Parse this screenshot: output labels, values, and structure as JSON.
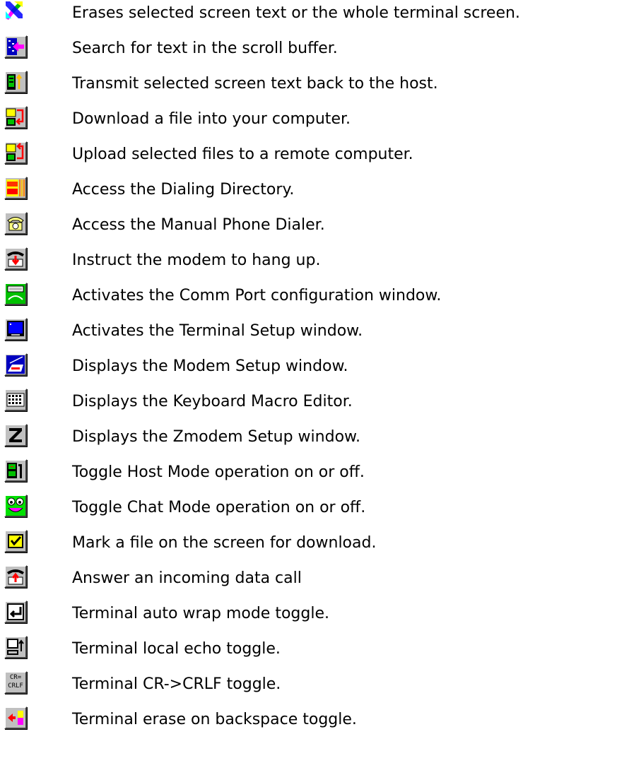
{
  "toolbar_help": {
    "items": [
      {
        "icon": "erase-screen-icon",
        "text": "Erases selected screen text or the whole terminal screen."
      },
      {
        "icon": "search-buffer-icon",
        "text": "Search for text in the scroll buffer."
      },
      {
        "icon": "transmit-text-icon",
        "text": "Transmit selected screen text back to the host."
      },
      {
        "icon": "download-file-icon",
        "text": "Download a file into your computer."
      },
      {
        "icon": "upload-file-icon",
        "text": "Upload selected files to a remote computer."
      },
      {
        "icon": "dialing-directory-icon",
        "text": "Access the Dialing Directory."
      },
      {
        "icon": "manual-dialer-icon",
        "text": "Access the Manual Phone Dialer."
      },
      {
        "icon": "hang-up-icon",
        "text": "Instruct the modem to hang up."
      },
      {
        "icon": "comm-port-icon",
        "text": "Activates the Comm Port configuration window."
      },
      {
        "icon": "terminal-setup-icon",
        "text": "Activates the Terminal Setup window."
      },
      {
        "icon": "modem-setup-icon",
        "text": "Displays the Modem Setup window."
      },
      {
        "icon": "keyboard-macro-icon",
        "text": "Displays the Keyboard Macro Editor."
      },
      {
        "icon": "zmodem-setup-icon",
        "text": "Displays the Zmodem Setup window."
      },
      {
        "icon": "host-mode-icon",
        "text": "Toggle Host Mode operation on or off."
      },
      {
        "icon": "chat-mode-icon",
        "text": "Toggle Chat Mode operation on or off."
      },
      {
        "icon": "mark-file-icon",
        "text": "Mark a file on the screen for download."
      },
      {
        "icon": "answer-call-icon",
        "text": "Answer an incoming data call"
      },
      {
        "icon": "auto-wrap-icon",
        "text": "Terminal auto wrap mode toggle."
      },
      {
        "icon": "local-echo-icon",
        "text": "Terminal local echo toggle."
      },
      {
        "icon": "cr-crlf-icon",
        "text": "Terminal CR->CRLF toggle.",
        "glyph": "CR=\nCRLF"
      },
      {
        "icon": "erase-backspace-icon",
        "text": "Terminal erase on backspace toggle."
      }
    ]
  }
}
